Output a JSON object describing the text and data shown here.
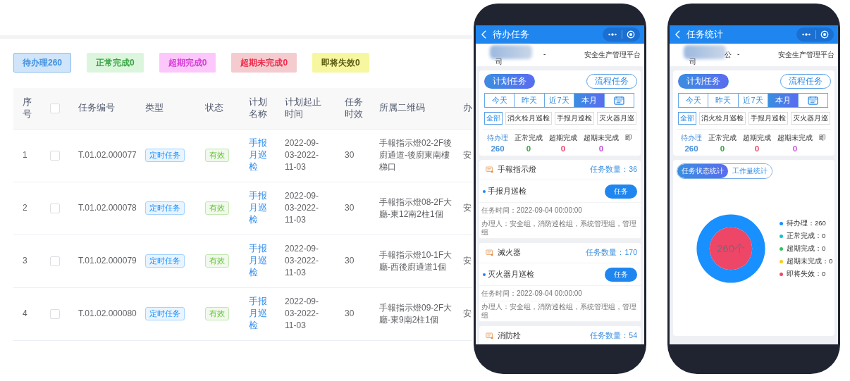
{
  "status_buttons": [
    {
      "label": "待办理260",
      "kind": "pending",
      "selected": true
    },
    {
      "label": "正常完成0",
      "kind": "normal",
      "selected": false
    },
    {
      "label": "超期完成0",
      "kind": "overdue_done",
      "selected": false
    },
    {
      "label": "超期未完成0",
      "kind": "overdue_undone",
      "selected": false
    },
    {
      "label": "即将失效0",
      "kind": "expiring",
      "selected": false
    }
  ],
  "table": {
    "header_checked": false,
    "columns": [
      "序号",
      "任务编号",
      "类型",
      "状态",
      "计划名称",
      "计划起止时间",
      "任务时效",
      "所属二维码",
      "办"
    ],
    "rows": [
      {
        "index": "1",
        "checked": false,
        "task_no": "T.01.02.000077",
        "type": "定时任务",
        "status": "有效",
        "plan": "手报月巡检",
        "period": "2022-09-03-2022-11-03",
        "duration": "30",
        "qr_code": "手報指示燈02-2F後廚通道-後廚東南樓梯口",
        "column_10": "安"
      },
      {
        "index": "2",
        "checked": false,
        "task_no": "T.01.02.000078",
        "type": "定时任务",
        "status": "有效",
        "plan": "手报月巡检",
        "period": "2022-09-03-2022-11-03",
        "duration": "30",
        "qr_code": "手報指示燈08-2F大廳-東12南2柱1個",
        "column_10": "安"
      },
      {
        "index": "3",
        "checked": false,
        "task_no": "T.01.02.000079",
        "type": "定时任务",
        "status": "有效",
        "plan": "手报月巡检",
        "period": "2022-09-03-2022-11-03",
        "duration": "30",
        "qr_code": "手報指示燈10-1F大廳-西後廚通道1個",
        "column_10": "安"
      },
      {
        "index": "4",
        "checked": false,
        "task_no": "T.01.02.000080",
        "type": "定时任务",
        "status": "有效",
        "plan": "手报月巡检",
        "period": "2022-09-03-2022-11-03",
        "duration": "30",
        "qr_code": "手報指示燈09-2F大廳-東9南2柱1個",
        "column_10": "安"
      }
    ]
  },
  "phones": [
    {
      "kind": "tasks",
      "title": "待办任务",
      "company": [
        "-",
        "司"
      ],
      "platform": "安全生产管理平台",
      "mode_tabs": [
        {
          "label": "计划任务",
          "selected": true
        },
        {
          "label": "流程任务",
          "selected": false
        }
      ],
      "date_tabs": [
        {
          "label": "今天",
          "selected": false
        },
        {
          "label": "昨天",
          "selected": false
        },
        {
          "label": "近7天",
          "selected": false
        },
        {
          "label": "本月",
          "selected": true
        }
      ],
      "chips": [
        {
          "label": "全部",
          "selected": true
        },
        {
          "label": "消火栓月巡检",
          "selected": false
        },
        {
          "label": "手报月巡检",
          "selected": false
        },
        {
          "label": "灭火器月巡",
          "selected": false
        }
      ],
      "stats": [
        {
          "label": "待办理",
          "value": "260",
          "color": "#4a90d9",
          "selected": true
        },
        {
          "label": "正常完成",
          "value": "0",
          "color": "#3aa443",
          "selected": false
        },
        {
          "label": "超期完成",
          "value": "0",
          "color": "#e8456a",
          "selected": false
        },
        {
          "label": "超期未完成",
          "value": "0",
          "color": "#c54fd8",
          "selected": false
        },
        {
          "label": "即",
          "selected": false
        }
      ],
      "groups": [
        {
          "name": "手報指示燈",
          "count": "任务数量：36",
          "task": "手报月巡检",
          "button": "任务",
          "time": "任务时间：2022-09-04 00:00:00",
          "handlers": "办理人：安全组，消防巡检组，系统管理组，管理组"
        },
        {
          "name": "滅火器",
          "count": "任务数量：170",
          "task": "灭火器月巡检",
          "button": "任务",
          "time": "任务时间：2022-09-04 00:00:00",
          "handlers": "办理人：安全组，消防巡检组，系统管理组，管理组"
        },
        {
          "name": "消防栓",
          "count": "任务数量：54"
        }
      ]
    },
    {
      "kind": "stats",
      "title": "任务统计",
      "company": [
        "公",
        "-",
        "司"
      ],
      "platform": "安全生产管理平台",
      "mode_tabs": [
        {
          "label": "计划任务",
          "selected": true
        },
        {
          "label": "流程任务",
          "selected": false
        }
      ],
      "date_tabs": [
        {
          "label": "今天",
          "selected": false
        },
        {
          "label": "昨天",
          "selected": false
        },
        {
          "label": "近7天",
          "selected": false
        },
        {
          "label": "本月",
          "selected": true
        }
      ],
      "chips": [
        {
          "label": "全部",
          "selected": true
        },
        {
          "label": "消火栓月巡检",
          "selected": false
        },
        {
          "label": "手报月巡检",
          "selected": false
        },
        {
          "label": "灭火器月巡",
          "selected": false
        }
      ],
      "stats": [
        {
          "label": "待办理",
          "value": "260",
          "color": "#4a90d9",
          "selected": true
        },
        {
          "label": "正常完成",
          "value": "0",
          "color": "#3aa443",
          "selected": false
        },
        {
          "label": "超期完成",
          "value": "0",
          "color": "#e8456a",
          "selected": false
        },
        {
          "label": "超期未完成",
          "value": "0",
          "color": "#c54fd8",
          "selected": false
        },
        {
          "label": "即",
          "selected": false
        }
      ],
      "stat_tabs": [
        {
          "label": "任务状态统计",
          "selected": true
        },
        {
          "label": "工作量统计",
          "selected": false
        }
      ],
      "center_label": "260个",
      "legend_separator": "：",
      "chart_data": {
        "type": "donut",
        "categories": [
          "待办理",
          "正常完成",
          "超期完成",
          "超期未完成",
          "即将失效"
        ],
        "value_labels": [
          "260",
          "0",
          "0",
          "0",
          "0"
        ],
        "colors": [
          "#1890ff",
          "#13c2c2",
          "#2fc25b",
          "#facc14",
          "#f04864"
        ],
        "series": [
          {
            "values": [
              100,
              0,
              0,
              0,
              0
            ]
          }
        ]
      }
    }
  ]
}
